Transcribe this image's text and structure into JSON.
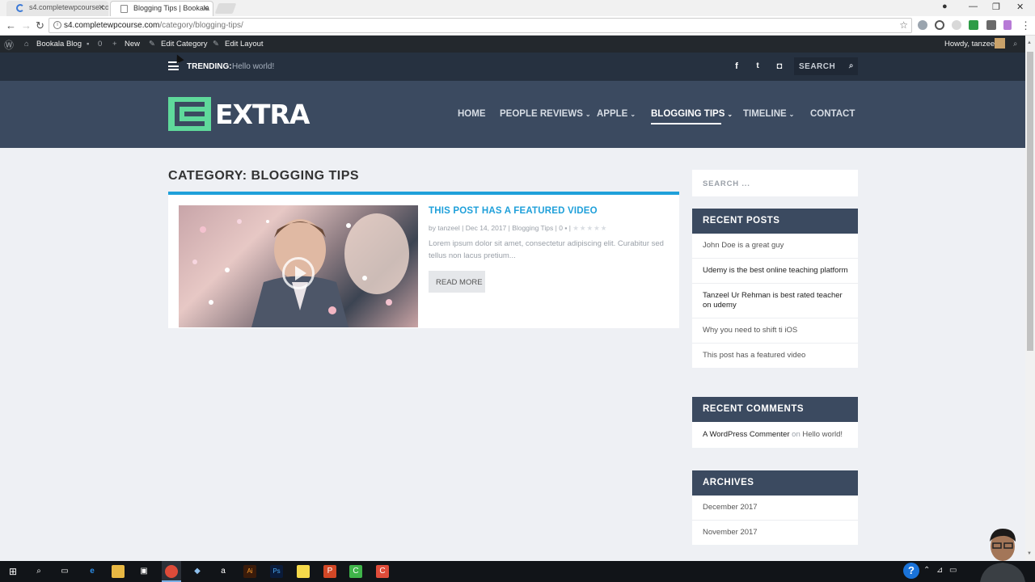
{
  "browser": {
    "tabs": [
      {
        "title": "s4.completewpcourse.co",
        "active": false
      },
      {
        "title": "Blogging Tips | Bookala",
        "active": true
      }
    ],
    "url_host": "s4.completewpcourse.com",
    "url_path": "/category/blogging-tips/"
  },
  "adminbar": {
    "site_name": "Bookala Blog",
    "comments_count": "0",
    "new_label": "New",
    "edit_category": "Edit Category",
    "edit_layout": "Edit Layout",
    "howdy": "Howdy, tanzeel"
  },
  "topbar": {
    "trending_label": "TRENDING:",
    "trending_link": "Hello world!",
    "search_label": "SEARCH",
    "social": [
      "f",
      "t",
      "ig"
    ]
  },
  "header": {
    "logo_text": "EXTRA",
    "nav": [
      {
        "label": "HOME",
        "has_caret": false,
        "active": false
      },
      {
        "label": "PEOPLE REVIEWS",
        "has_caret": true,
        "active": false
      },
      {
        "label": "APPLE",
        "has_caret": true,
        "active": false
      },
      {
        "label": "BLOGGING TIPS",
        "has_caret": true,
        "active": true
      },
      {
        "label": "TIMELINE",
        "has_caret": true,
        "active": false
      },
      {
        "label": "CONTACT",
        "has_caret": false,
        "active": false
      }
    ]
  },
  "main": {
    "category_title": "CATEGORY: BLOGGING TIPS",
    "post": {
      "title": "THIS POST HAS A FEATURED VIDEO",
      "meta_by": "by",
      "meta_author": "tanzeel",
      "meta_date": "Dec 14, 2017",
      "meta_category": "Blogging Tips",
      "meta_comments": "0",
      "excerpt": "Lorem ipsum dolor sit amet, consectetur adipiscing elit. Curabitur sed tellus non lacus pretium...",
      "read_more": "READ MORE"
    }
  },
  "sidebar": {
    "search_placeholder": "SEARCH ...",
    "recent_posts_title": "RECENT POSTS",
    "recent_posts": [
      "John Doe is a great guy",
      "Udemy is the best online teaching platform",
      "Tanzeel Ur Rehman is best rated teacher on udemy",
      "Why you need to shift ti iOS",
      "This post has a featured video"
    ],
    "recent_comments_title": "RECENT COMMENTS",
    "comment_author": "A WordPress Commenter",
    "comment_on": "on",
    "comment_post": "Hello world!",
    "archives_title": "ARCHIVES",
    "archives": [
      "December 2017",
      "November 2017"
    ]
  },
  "colors": {
    "accent": "#1fa0da",
    "header_bg": "#3b4a60",
    "topbar_bg": "#263140",
    "logo_green": "#5fd99b"
  }
}
